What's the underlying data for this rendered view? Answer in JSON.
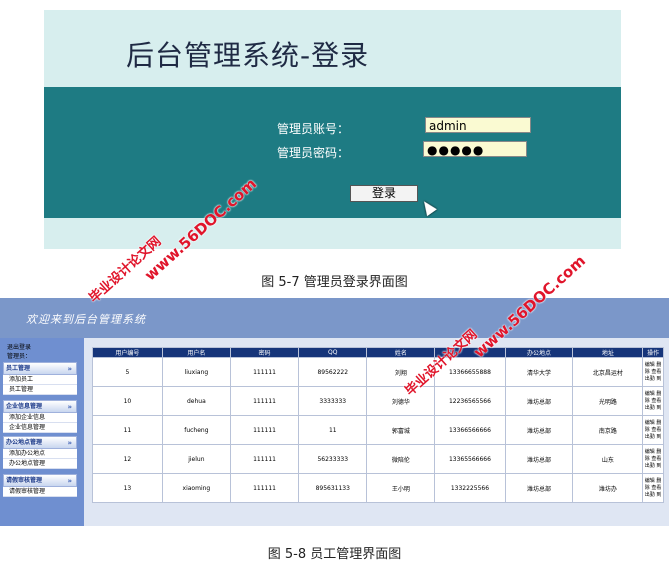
{
  "login": {
    "title": "后台管理系统-登录",
    "account_label": "管理员账号：",
    "account_value": "admin",
    "password_label": "管理员密码：",
    "password_value": "●●●●●",
    "login_button": "登录"
  },
  "caption_login": "图 5-7  管理员登录界面图",
  "admin": {
    "welcome": "欢迎来到后台管理系统",
    "exit_label": "退出登录",
    "user_label": "管理员：",
    "sections": [
      {
        "title": "员工管理",
        "items": [
          "添加员工",
          "员工管理"
        ]
      },
      {
        "title": "企业信息管理",
        "items": [
          "添加企业信息",
          "企业信息管理"
        ]
      },
      {
        "title": "办公地点管理",
        "items": [
          "添加办公地点",
          "办公地点管理"
        ]
      },
      {
        "title": "请假审核管理",
        "items": [
          "请假审核管理"
        ]
      }
    ],
    "table": {
      "headers": [
        "用户编号",
        "用户名",
        "密码",
        "QQ",
        "姓名",
        "",
        "办公地点",
        "地址",
        "操作"
      ],
      "rows": [
        [
          "5",
          "liuxiang",
          "111111",
          "89562222",
          "刘翔",
          "13366655888",
          "清华大学",
          "北京昌运村"
        ],
        [
          "10",
          "dehua",
          "111111",
          "3333333",
          "刘德华",
          "12236565566",
          "潍坊总部",
          "光明路"
        ],
        [
          "11",
          "fucheng",
          "111111",
          "11",
          "郭富城",
          "13366566666",
          "潍坊总部",
          "南京路"
        ],
        [
          "12",
          "jielun",
          "111111",
          "56233333",
          "微陪伦",
          "13365566666",
          "潍坊总部",
          "山东"
        ],
        [
          "13",
          "xiaoming",
          "111111",
          "895631133",
          "王小明",
          "1332225566",
          "潍坊总部",
          "潍坊办"
        ]
      ],
      "op_label": "编辑 删除 查看出勤 到"
    }
  },
  "caption_admin": "图 5-8  员工管理界面图",
  "watermarks": {
    "site": "www.56DOC.com",
    "cn": "毕业设计论文网"
  }
}
